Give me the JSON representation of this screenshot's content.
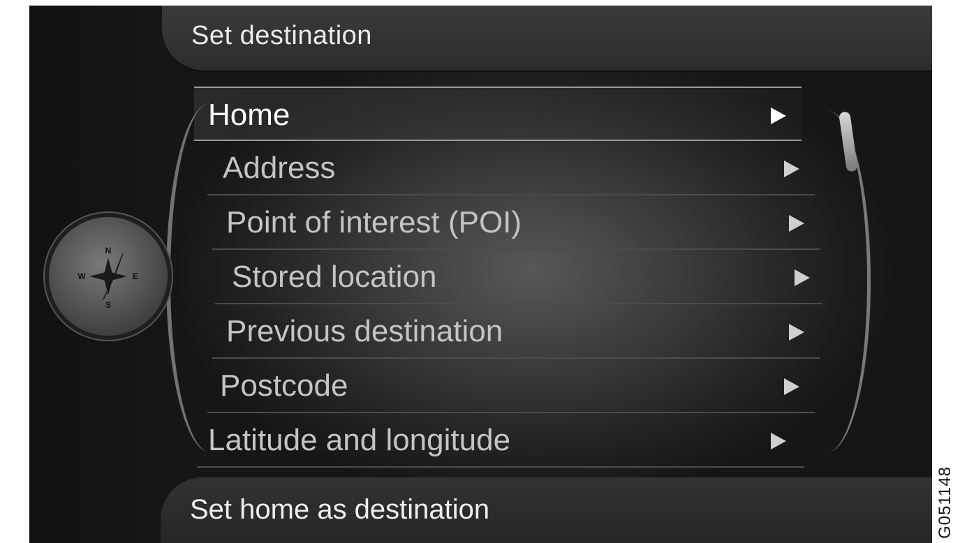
{
  "header": {
    "title": "Set destination"
  },
  "menu": {
    "items": [
      {
        "label": "Home",
        "selected": true
      },
      {
        "label": "Address",
        "selected": false
      },
      {
        "label": "Point of interest (POI)",
        "selected": false
      },
      {
        "label": "Stored location",
        "selected": false
      },
      {
        "label": "Previous destination",
        "selected": false
      },
      {
        "label": "Postcode",
        "selected": false
      },
      {
        "label": "Latitude and longitude",
        "selected": false
      }
    ],
    "arrow_icon": "chevron-right-icon"
  },
  "footer": {
    "description": "Set home as destination"
  },
  "compass": {
    "north": "N",
    "south": "S",
    "east": "E",
    "west": "W",
    "icon": "compass-icon"
  },
  "figure_id": "G051148",
  "colors": {
    "background": "#151515",
    "text": "#ececec",
    "selected_text": "#ffffff",
    "item_text": "#c4c4c4"
  }
}
